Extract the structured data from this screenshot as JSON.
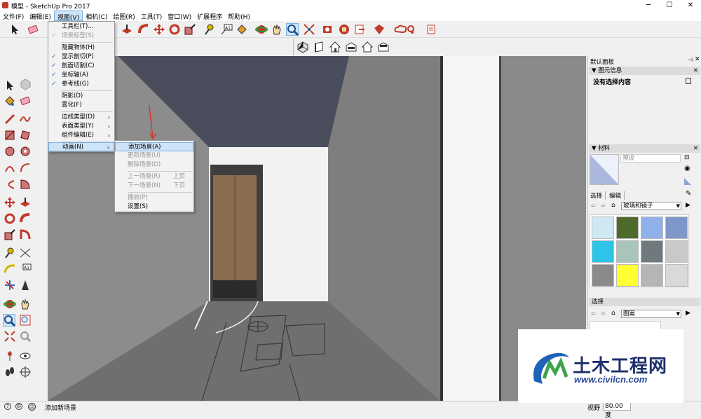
{
  "window": {
    "title": "模型 - SketchUp Pro 2017",
    "minimize": "─",
    "maximize": "☐",
    "close": "✕"
  },
  "menubar": {
    "items": [
      "文件(F)",
      "编辑(E)",
      "视图(V)",
      "相机(C)",
      "绘图(R)",
      "工具(T)",
      "窗口(W)",
      "扩展程序",
      "帮助(H)"
    ],
    "active_index": 2
  },
  "view_menu": {
    "items": [
      {
        "label": "工具栏(T)...",
        "checked": false,
        "disabled": false,
        "submenu": false
      },
      {
        "label": "场景标签(S)",
        "checked": true,
        "disabled": true,
        "submenu": false
      },
      {
        "label": "隐藏物体(H)",
        "checked": false,
        "disabled": false,
        "submenu": false
      },
      {
        "label": "显示剖切(P)",
        "checked": true,
        "disabled": false,
        "submenu": false
      },
      {
        "label": "剖面切割(C)",
        "checked": true,
        "disabled": false,
        "submenu": false
      },
      {
        "label": "坐标轴(A)",
        "checked": true,
        "disabled": false,
        "submenu": false
      },
      {
        "label": "参考线(G)",
        "checked": true,
        "disabled": false,
        "submenu": false
      },
      {
        "label": "阴影(D)",
        "checked": false,
        "disabled": false,
        "submenu": false
      },
      {
        "label": "雾化(F)",
        "checked": false,
        "disabled": false,
        "submenu": false
      },
      {
        "label": "边线类型(D)",
        "checked": false,
        "disabled": false,
        "submenu": true
      },
      {
        "label": "表面类型(Y)",
        "checked": false,
        "disabled": false,
        "submenu": true
      },
      {
        "label": "组件编辑(E)",
        "checked": false,
        "disabled": false,
        "submenu": true
      },
      {
        "label": "动画(N)",
        "checked": false,
        "disabled": false,
        "submenu": true,
        "highlighted": true
      }
    ]
  },
  "animation_menu": {
    "items": [
      {
        "label": "添加场景(A)",
        "shortcut": "",
        "disabled": false,
        "highlighted": true
      },
      {
        "label": "更新场景(U)",
        "shortcut": "",
        "disabled": true
      },
      {
        "label": "删除场景(D)",
        "shortcut": "",
        "disabled": true
      },
      {
        "label": "上一场景(R)",
        "shortcut": "上页",
        "disabled": true
      },
      {
        "label": "下一场景(N)",
        "shortcut": "下页",
        "disabled": true
      },
      {
        "label": "播放(P)",
        "shortcut": "",
        "disabled": true
      },
      {
        "label": "设置(S)",
        "shortcut": "",
        "disabled": false
      }
    ]
  },
  "tray": {
    "title": "默认面板",
    "entity_info": {
      "header": "图元信息",
      "content": "没有选择内容"
    },
    "materials": {
      "header": "材料",
      "name_field": "预设",
      "tabs": [
        "选择",
        "编辑"
      ],
      "collection": "玻璃和镜子",
      "swatch_colors": [
        "#cfe8f2",
        "#4f6b2c",
        "#8fb0e8",
        "#7f97c8",
        "#2ec4e8",
        "#a9c4b8",
        "#6f7a7f",
        "#c9c9c9",
        "#8a8a8a",
        "#ffff33",
        "#b5b5b5",
        "#d9d9d9"
      ]
    },
    "select2": {
      "header": "选择",
      "collection": "图案"
    }
  },
  "status": {
    "text": "添加新场景",
    "vcb_label": "视野",
    "vcb_value": "80.00 度"
  },
  "watermark": {
    "text": "土木工程网",
    "url": "www.civilcn.com"
  }
}
